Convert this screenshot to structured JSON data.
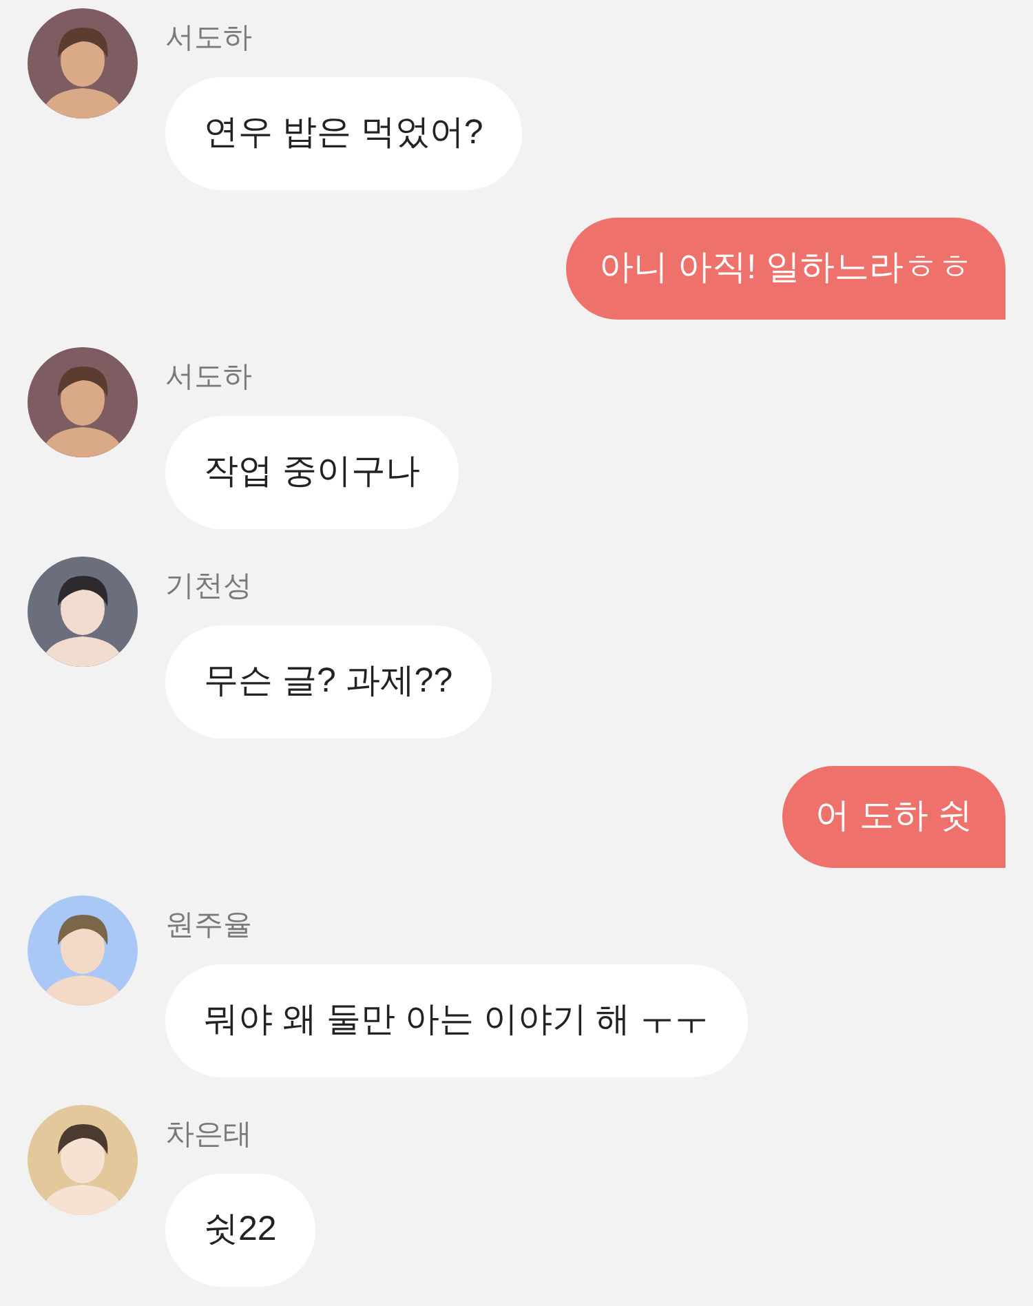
{
  "messages": [
    {
      "kind": "incoming",
      "sender": "서도하",
      "text": "연우 밥은 먹었어?"
    },
    {
      "kind": "outgoing",
      "text": "아니 아직! 일하느라ㅎㅎ"
    },
    {
      "kind": "incoming",
      "sender": "서도하",
      "text": "작업 중이구나"
    },
    {
      "kind": "incoming",
      "sender": "기천성",
      "text": "무슨 글? 과제??"
    },
    {
      "kind": "outgoing",
      "text": "어 도하 쉿"
    },
    {
      "kind": "incoming",
      "sender": "원주율",
      "text": "뭐야 왜 둘만 아는 이야기 해 ㅜㅜ"
    },
    {
      "kind": "incoming",
      "sender": "차은태",
      "text": "쉿22"
    }
  ]
}
